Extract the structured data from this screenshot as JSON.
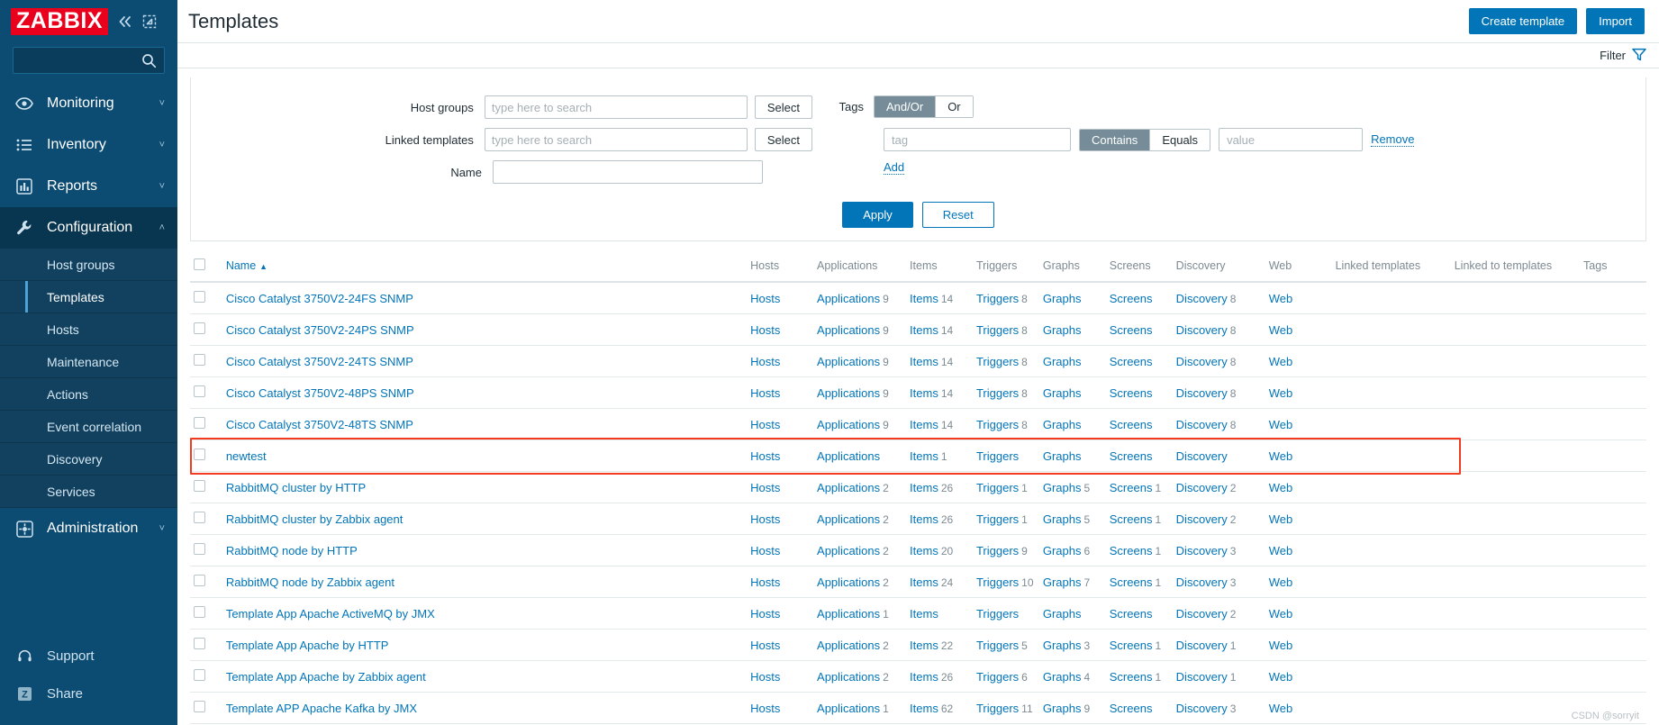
{
  "brand": {
    "logo": "ZABBIX",
    "collapse_icon": "chevron-double-left-icon",
    "expand_icon": "expand-icon"
  },
  "sidebar": {
    "search": {
      "value": "",
      "placeholder": "",
      "icon": "search-icon"
    },
    "items": [
      {
        "label": "Monitoring",
        "icon": "eye-icon",
        "chevron": "˅",
        "active": false
      },
      {
        "label": "Inventory",
        "icon": "list-icon",
        "chevron": "˅",
        "active": false
      },
      {
        "label": "Reports",
        "icon": "bar-chart-icon",
        "chevron": "˅",
        "active": false
      },
      {
        "label": "Configuration",
        "icon": "wrench-icon",
        "chevron": "˄",
        "active": true
      },
      {
        "label": "Administration",
        "icon": "gear-icon",
        "chevron": "˅",
        "active": false
      }
    ],
    "submenu": [
      {
        "label": "Host groups",
        "active": false
      },
      {
        "label": "Templates",
        "active": true
      },
      {
        "label": "Hosts",
        "active": false
      },
      {
        "label": "Maintenance",
        "active": false
      },
      {
        "label": "Actions",
        "active": false
      },
      {
        "label": "Event correlation",
        "active": false
      },
      {
        "label": "Discovery",
        "active": false
      },
      {
        "label": "Services",
        "active": false
      }
    ],
    "bottom": [
      {
        "label": "Support",
        "icon": "headset-icon"
      },
      {
        "label": "Share",
        "icon": "zabbix-share-icon"
      }
    ]
  },
  "header": {
    "title": "Templates",
    "create_label": "Create template",
    "import_label": "Import"
  },
  "filter": {
    "tab_label": "Filter",
    "tab_icon": "funnel-icon",
    "host_groups": {
      "label": "Host groups",
      "value": "",
      "placeholder": "type here to search",
      "select_label": "Select"
    },
    "linked_templates": {
      "label": "Linked templates",
      "value": "",
      "placeholder": "type here to search",
      "select_label": "Select"
    },
    "name": {
      "label": "Name",
      "value": "",
      "placeholder": ""
    },
    "tags": {
      "label": "Tags",
      "operators": [
        {
          "label": "And/Or",
          "selected": true
        },
        {
          "label": "Or",
          "selected": false
        }
      ],
      "tag_input": {
        "value": "",
        "placeholder": "tag"
      },
      "match": [
        {
          "label": "Contains",
          "selected": true
        },
        {
          "label": "Equals",
          "selected": false
        }
      ],
      "value_input": {
        "value": "",
        "placeholder": "value"
      },
      "remove_label": "Remove",
      "add_label": "Add"
    },
    "apply_label": "Apply",
    "reset_label": "Reset"
  },
  "table": {
    "columns": [
      "Name",
      "Hosts",
      "Applications",
      "Items",
      "Triggers",
      "Graphs",
      "Screens",
      "Discovery",
      "Web",
      "Linked templates",
      "Linked to templates",
      "Tags"
    ],
    "sort_column": "Name",
    "sort_dir": "▲",
    "link_labels": {
      "hosts": "Hosts",
      "applications": "Applications",
      "items": "Items",
      "triggers": "Triggers",
      "graphs": "Graphs",
      "screens": "Screens",
      "discovery": "Discovery",
      "web": "Web"
    },
    "rows": [
      {
        "name": "Cisco Catalyst 3750V2-24FS SNMP",
        "applications": "9",
        "items": "14",
        "triggers": "8",
        "graphs": "",
        "screens": "",
        "discovery": "8",
        "highlighted": false
      },
      {
        "name": "Cisco Catalyst 3750V2-24PS SNMP",
        "applications": "9",
        "items": "14",
        "triggers": "8",
        "graphs": "",
        "screens": "",
        "discovery": "8",
        "highlighted": false
      },
      {
        "name": "Cisco Catalyst 3750V2-24TS SNMP",
        "applications": "9",
        "items": "14",
        "triggers": "8",
        "graphs": "",
        "screens": "",
        "discovery": "8",
        "highlighted": false
      },
      {
        "name": "Cisco Catalyst 3750V2-48PS SNMP",
        "applications": "9",
        "items": "14",
        "triggers": "8",
        "graphs": "",
        "screens": "",
        "discovery": "8",
        "highlighted": false
      },
      {
        "name": "Cisco Catalyst 3750V2-48TS SNMP",
        "applications": "9",
        "items": "14",
        "triggers": "8",
        "graphs": "",
        "screens": "",
        "discovery": "8",
        "highlighted": false
      },
      {
        "name": "newtest",
        "applications": "",
        "items": "1",
        "triggers": "",
        "graphs": "",
        "screens": "",
        "discovery": "",
        "highlighted": true
      },
      {
        "name": "RabbitMQ cluster by HTTP",
        "applications": "2",
        "items": "26",
        "triggers": "1",
        "graphs": "5",
        "screens": "1",
        "discovery": "2",
        "highlighted": false
      },
      {
        "name": "RabbitMQ cluster by Zabbix agent",
        "applications": "2",
        "items": "26",
        "triggers": "1",
        "graphs": "5",
        "screens": "1",
        "discovery": "2",
        "highlighted": false
      },
      {
        "name": "RabbitMQ node by HTTP",
        "applications": "2",
        "items": "20",
        "triggers": "9",
        "graphs": "6",
        "screens": "1",
        "discovery": "3",
        "highlighted": false
      },
      {
        "name": "RabbitMQ node by Zabbix agent",
        "applications": "2",
        "items": "24",
        "triggers": "10",
        "graphs": "7",
        "screens": "1",
        "discovery": "3",
        "highlighted": false
      },
      {
        "name": "Template App Apache ActiveMQ by JMX",
        "applications": "1",
        "items": "",
        "triggers": "",
        "graphs": "",
        "screens": "",
        "discovery": "2",
        "highlighted": false
      },
      {
        "name": "Template App Apache by HTTP",
        "applications": "2",
        "items": "22",
        "triggers": "5",
        "graphs": "3",
        "screens": "1",
        "discovery": "1",
        "highlighted": false
      },
      {
        "name": "Template App Apache by Zabbix agent",
        "applications": "2",
        "items": "26",
        "triggers": "6",
        "graphs": "4",
        "screens": "1",
        "discovery": "1",
        "highlighted": false
      },
      {
        "name": "Template APP Apache Kafka by JMX",
        "applications": "1",
        "items": "62",
        "triggers": "11",
        "graphs": "9",
        "screens": "",
        "discovery": "3",
        "highlighted": false
      }
    ]
  },
  "watermark": "CSDN @sorryit"
}
